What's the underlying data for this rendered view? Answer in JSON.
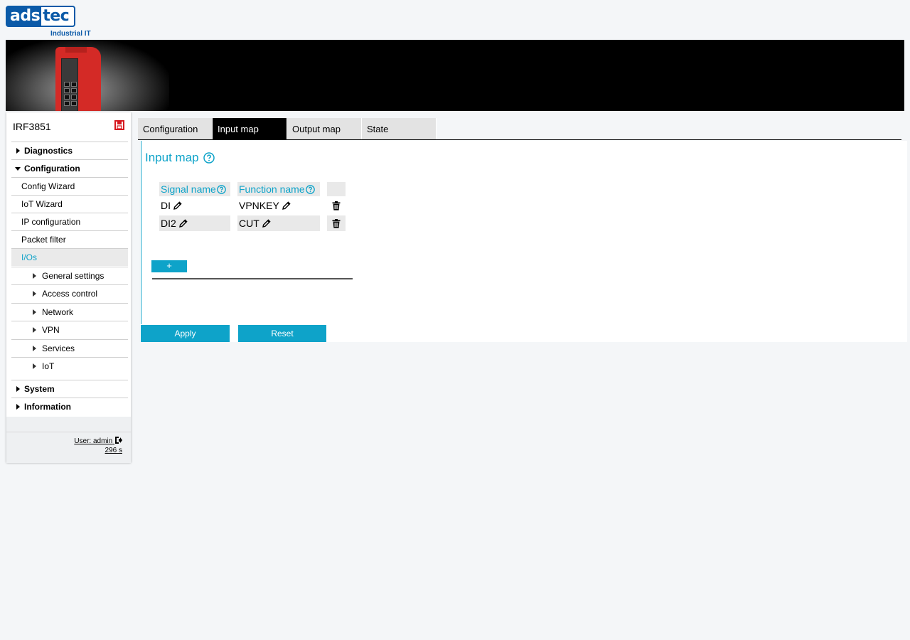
{
  "brand": {
    "logo_left": "ads",
    "logo_right": "tec",
    "subtitle": "Industrial IT",
    "accent": "#0ea3c9",
    "logo_blue": "#0b5aa8"
  },
  "sidebar": {
    "device_name": "IRF3851",
    "items": [
      {
        "label": "Diagnostics",
        "level": 1,
        "expanded": false
      },
      {
        "label": "Configuration",
        "level": 1,
        "expanded": true
      },
      {
        "label": "Config Wizard",
        "level": 2
      },
      {
        "label": "IoT Wizard",
        "level": 2
      },
      {
        "label": "IP configuration",
        "level": 2
      },
      {
        "label": "Packet filter",
        "level": 2
      },
      {
        "label": "I/Os",
        "level": 2,
        "active": true
      },
      {
        "label": "General settings",
        "level": 3
      },
      {
        "label": "Access control",
        "level": 3
      },
      {
        "label": "Network",
        "level": 3
      },
      {
        "label": "VPN",
        "level": 3
      },
      {
        "label": "Services",
        "level": 3
      },
      {
        "label": "IoT",
        "level": 3
      },
      {
        "label": "System",
        "level": 1,
        "expanded": false
      },
      {
        "label": "Information",
        "level": 1,
        "expanded": false
      }
    ],
    "user": "User: admin",
    "session_time": "296 s"
  },
  "tabs": [
    {
      "label": "Configuration",
      "active": false
    },
    {
      "label": "Input map",
      "active": true
    },
    {
      "label": "Output map",
      "active": false
    },
    {
      "label": "State",
      "active": false
    }
  ],
  "main": {
    "title": "Input map",
    "columns": [
      "Signal name",
      "Function name"
    ],
    "rows": [
      {
        "signal": "DI",
        "function": "VPNKEY"
      },
      {
        "signal": "DI2",
        "function": "CUT"
      }
    ],
    "add_label": "+",
    "apply_label": "Apply",
    "reset_label": "Reset"
  }
}
